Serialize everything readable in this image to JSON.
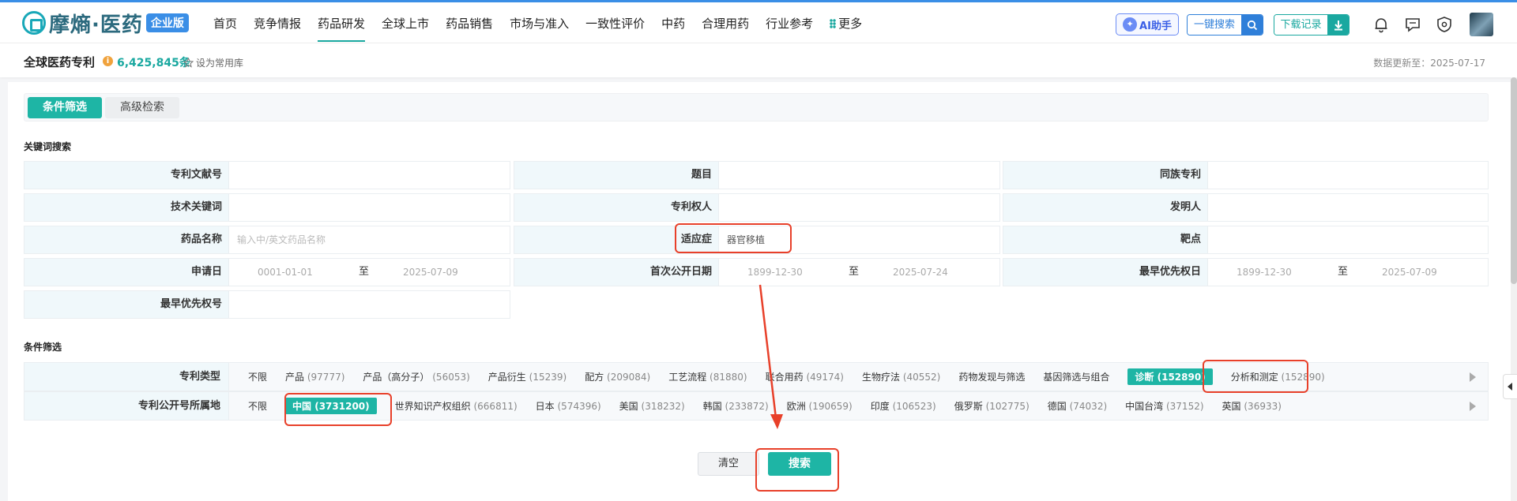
{
  "brand": {
    "name": "摩熵·医药",
    "edition": "企业版"
  },
  "nav": {
    "items": [
      {
        "label": "首页",
        "active": false
      },
      {
        "label": "竞争情报",
        "active": false
      },
      {
        "label": "药品研发",
        "active": true
      },
      {
        "label": "全球上市",
        "active": false
      },
      {
        "label": "药品销售",
        "active": false
      },
      {
        "label": "市场与准入",
        "active": false
      },
      {
        "label": "一致性评价",
        "active": false
      },
      {
        "label": "中药",
        "active": false
      },
      {
        "label": "合理用药",
        "active": false
      },
      {
        "label": "行业参考",
        "active": false
      }
    ],
    "more_label": "更多",
    "ai_label": "AI助手",
    "quick_search_label": "一键搜索",
    "download_label": "下载记录"
  },
  "subheader": {
    "title": "全球医药专利",
    "count": "6,425,845条",
    "favorite_label": "设为常用库",
    "update_time": "数据更新至：2025-07-17"
  },
  "tabs": [
    {
      "label": "条件筛选",
      "active": true
    },
    {
      "label": "高级检索",
      "active": false
    }
  ],
  "keyword_section": {
    "title": "关键词搜索",
    "fields": [
      {
        "label": "专利文献号",
        "value": ""
      },
      {
        "label": "题目",
        "value": ""
      },
      {
        "label": "同族专利",
        "value": ""
      },
      {
        "label": "技术关键词",
        "value": ""
      },
      {
        "label": "专利权人",
        "value": ""
      },
      {
        "label": "发明人",
        "value": ""
      },
      {
        "label": "药品名称",
        "value": "",
        "placeholder": "输入中/英文药品名称"
      },
      {
        "label": "适应症",
        "value": "器官移植"
      },
      {
        "label": "靶点",
        "value": ""
      }
    ],
    "date_fields": [
      {
        "label": "申请日",
        "from": "0001-01-01",
        "to_label": "至",
        "to": "2025-07-09"
      },
      {
        "label": "首次公开日期",
        "from": "1899-12-30",
        "to_label": "至",
        "to": "2025-07-24"
      },
      {
        "label": "最早优先权日",
        "from": "1899-12-30",
        "to_label": "至",
        "to": "2025-07-09"
      }
    ],
    "priority_field": {
      "label": "最早优先权号",
      "value": ""
    }
  },
  "filter_section": {
    "title": "条件筛选",
    "rows": [
      {
        "label": "专利类型",
        "options": [
          {
            "name": "不限",
            "count": "",
            "selected": false
          },
          {
            "name": "产品",
            "count": "(97777)",
            "selected": false
          },
          {
            "name": "产品（高分子）",
            "count": "(56053)",
            "selected": false
          },
          {
            "name": "产品衍生",
            "count": "(15239)",
            "selected": false
          },
          {
            "name": "配方",
            "count": "(209084)",
            "selected": false
          },
          {
            "name": "工艺流程",
            "count": "(81880)",
            "selected": false
          },
          {
            "name": "联合用药",
            "count": "(49174)",
            "selected": false
          },
          {
            "name": "生物疗法",
            "count": "(40552)",
            "selected": false
          },
          {
            "name": "药物发现与筛选",
            "count": "",
            "selected": false
          },
          {
            "name": "基因筛选与组合",
            "count": "",
            "selected": false
          },
          {
            "name": "诊断",
            "count": "(152890)",
            "selected": true
          },
          {
            "name": "分析和测定",
            "count": "(152890)",
            "selected": false
          }
        ]
      },
      {
        "label": "专利公开号所属地",
        "options": [
          {
            "name": "不限",
            "count": "",
            "selected": false
          },
          {
            "name": "中国",
            "count": "(3731200)",
            "selected": true
          },
          {
            "name": "世界知识产权组织",
            "count": "(666811)",
            "selected": false
          },
          {
            "name": "日本",
            "count": "(574396)",
            "selected": false
          },
          {
            "name": "美国",
            "count": "(318232)",
            "selected": false
          },
          {
            "name": "韩国",
            "count": "(233872)",
            "selected": false
          },
          {
            "name": "欧洲",
            "count": "(190659)",
            "selected": false
          },
          {
            "name": "印度",
            "count": "(106523)",
            "selected": false
          },
          {
            "name": "俄罗斯",
            "count": "(102775)",
            "selected": false
          },
          {
            "name": "德国",
            "count": "(74032)",
            "selected": false
          },
          {
            "name": "中国台湾",
            "count": "(37152)",
            "selected": false
          },
          {
            "name": "英国",
            "count": "(36933)",
            "selected": false
          }
        ]
      }
    ]
  },
  "actions": {
    "clear_label": "清空",
    "search_label": "搜索"
  },
  "colors": {
    "accent": "#1eb5a5",
    "highlight": "#e8402a",
    "brand_blue": "#3a8ee6"
  }
}
